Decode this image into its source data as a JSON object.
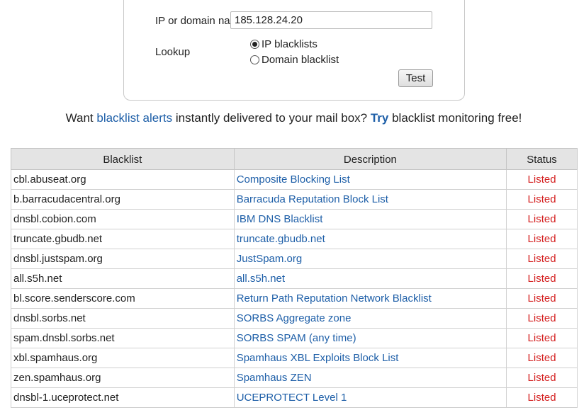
{
  "form": {
    "ip_label": "IP or domain name",
    "ip_value": "185.128.24.20",
    "lookup_label": "Lookup",
    "option_ip": "IP blacklists",
    "option_domain": "Domain blacklist",
    "selected": "IP blacklists",
    "test_label": "Test"
  },
  "promo": {
    "prefix": "Want ",
    "link1": "blacklist alerts",
    "middle": " instantly delivered to your mail box? ",
    "link2": "Try",
    "suffix": " blacklist monitoring free!"
  },
  "table": {
    "headers": [
      "Blacklist",
      "Description",
      "Status"
    ],
    "rows": [
      {
        "blacklist": "cbl.abuseat.org",
        "description": "Composite Blocking List",
        "status": "Listed"
      },
      {
        "blacklist": "b.barracudacentral.org",
        "description": "Barracuda Reputation Block List",
        "status": "Listed"
      },
      {
        "blacklist": "dnsbl.cobion.com",
        "description": "IBM DNS Blacklist",
        "status": "Listed"
      },
      {
        "blacklist": "truncate.gbudb.net",
        "description": "truncate.gbudb.net",
        "status": "Listed"
      },
      {
        "blacklist": "dnsbl.justspam.org",
        "description": "JustSpam.org",
        "status": "Listed"
      },
      {
        "blacklist": "all.s5h.net",
        "description": "all.s5h.net",
        "status": "Listed"
      },
      {
        "blacklist": "bl.score.senderscore.com",
        "description": "Return Path Reputation Network Blacklist",
        "status": "Listed"
      },
      {
        "blacklist": "dnsbl.sorbs.net",
        "description": "SORBS Aggregate zone",
        "status": "Listed"
      },
      {
        "blacklist": "spam.dnsbl.sorbs.net",
        "description": "SORBS SPAM (any time)",
        "status": "Listed"
      },
      {
        "blacklist": "xbl.spamhaus.org",
        "description": "Spamhaus XBL Exploits Block List",
        "status": "Listed"
      },
      {
        "blacklist": "zen.spamhaus.org",
        "description": "Spamhaus ZEN",
        "status": "Listed"
      },
      {
        "blacklist": "dnsbl-1.uceprotect.net",
        "description": "UCEPROTECT Level 1",
        "status": "Listed"
      }
    ]
  },
  "colors": {
    "link": "#1e5fa8",
    "listed": "#d42020",
    "header_bg": "#e4e4e4"
  }
}
